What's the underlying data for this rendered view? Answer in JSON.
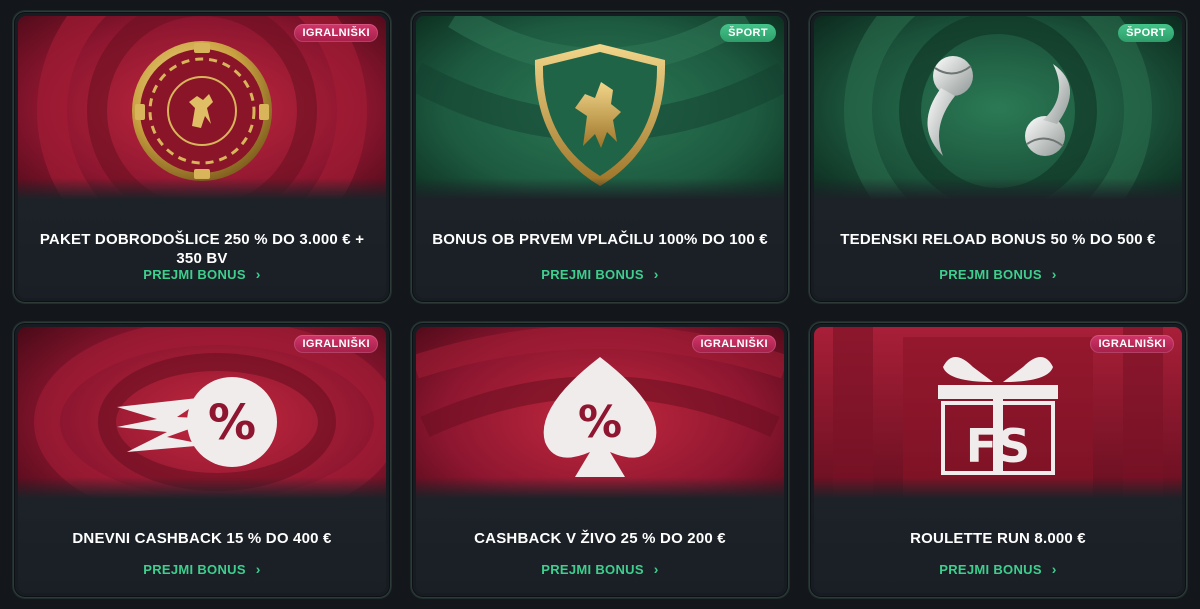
{
  "cards": [
    {
      "category": "IGRALNIŠKI",
      "title": "PAKET DOBRODOŠLICE 250 % DO 3.000 € + 350 BV",
      "cta": "PREJMI BONUS",
      "art": "casino-chip-lion-icon"
    },
    {
      "category": "ŠPORT",
      "title": "BONUS OB PRVEM VPLAČILU 100% DO 100 €",
      "cta": "PREJMI BONUS",
      "art": "lion-shield-icon"
    },
    {
      "category": "ŠPORT",
      "title": "TEDENSKI RELOAD BONUS 50 % DO 500 €",
      "cta": "PREJMI BONUS",
      "art": "tennis-balls-icon"
    },
    {
      "category": "IGRALNIŠKI",
      "title": "DNEVNI CASHBACK 15 % DO 400 €",
      "cta": "PREJMI BONUS",
      "art": "speed-percent-icon"
    },
    {
      "category": "IGRALNIŠKI",
      "title": "CASHBACK V ŽIVO 25 % DO 200 €",
      "cta": "PREJMI BONUS",
      "art": "spade-percent-icon"
    },
    {
      "category": "IGRALNIŠKI",
      "title": "ROULETTE RUN 8.000 €",
      "cta": "PREJMI BONUS",
      "art": "gift-fs-icon"
    }
  ],
  "colors": {
    "casino_red": "#8e1630",
    "sport_green": "#1d5a40",
    "accent_green": "#3ecf8e",
    "badge_pink": "#c12b5b",
    "background": "#13171c"
  },
  "chevron_icon": "chevron-right-icon"
}
